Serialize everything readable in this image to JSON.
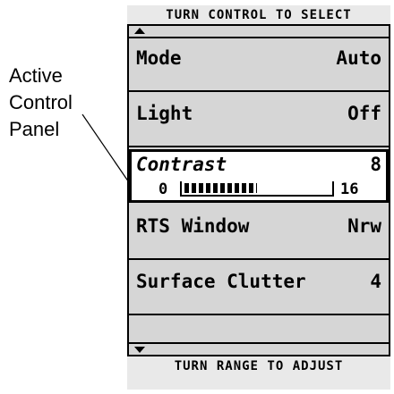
{
  "callout": {
    "lines": [
      "Active",
      "Control",
      "Panel"
    ]
  },
  "screen": {
    "header_hint": "TURN CONTROL TO SELECT",
    "footer_hint": "TURN RANGE TO ADJUST",
    "scroll_up_icon": "triangle-up",
    "scroll_down_icon": "triangle-down"
  },
  "rows": [
    {
      "label": "Mode",
      "value": "Auto"
    },
    {
      "label": "Light",
      "value": "Off"
    },
    {
      "label": "Contrast",
      "value": "8",
      "min": "0",
      "max": "16",
      "level": 0.5
    },
    {
      "label": "RTS Window",
      "value": "Nrw"
    },
    {
      "label": "Surface Clutter",
      "value": "4"
    }
  ]
}
